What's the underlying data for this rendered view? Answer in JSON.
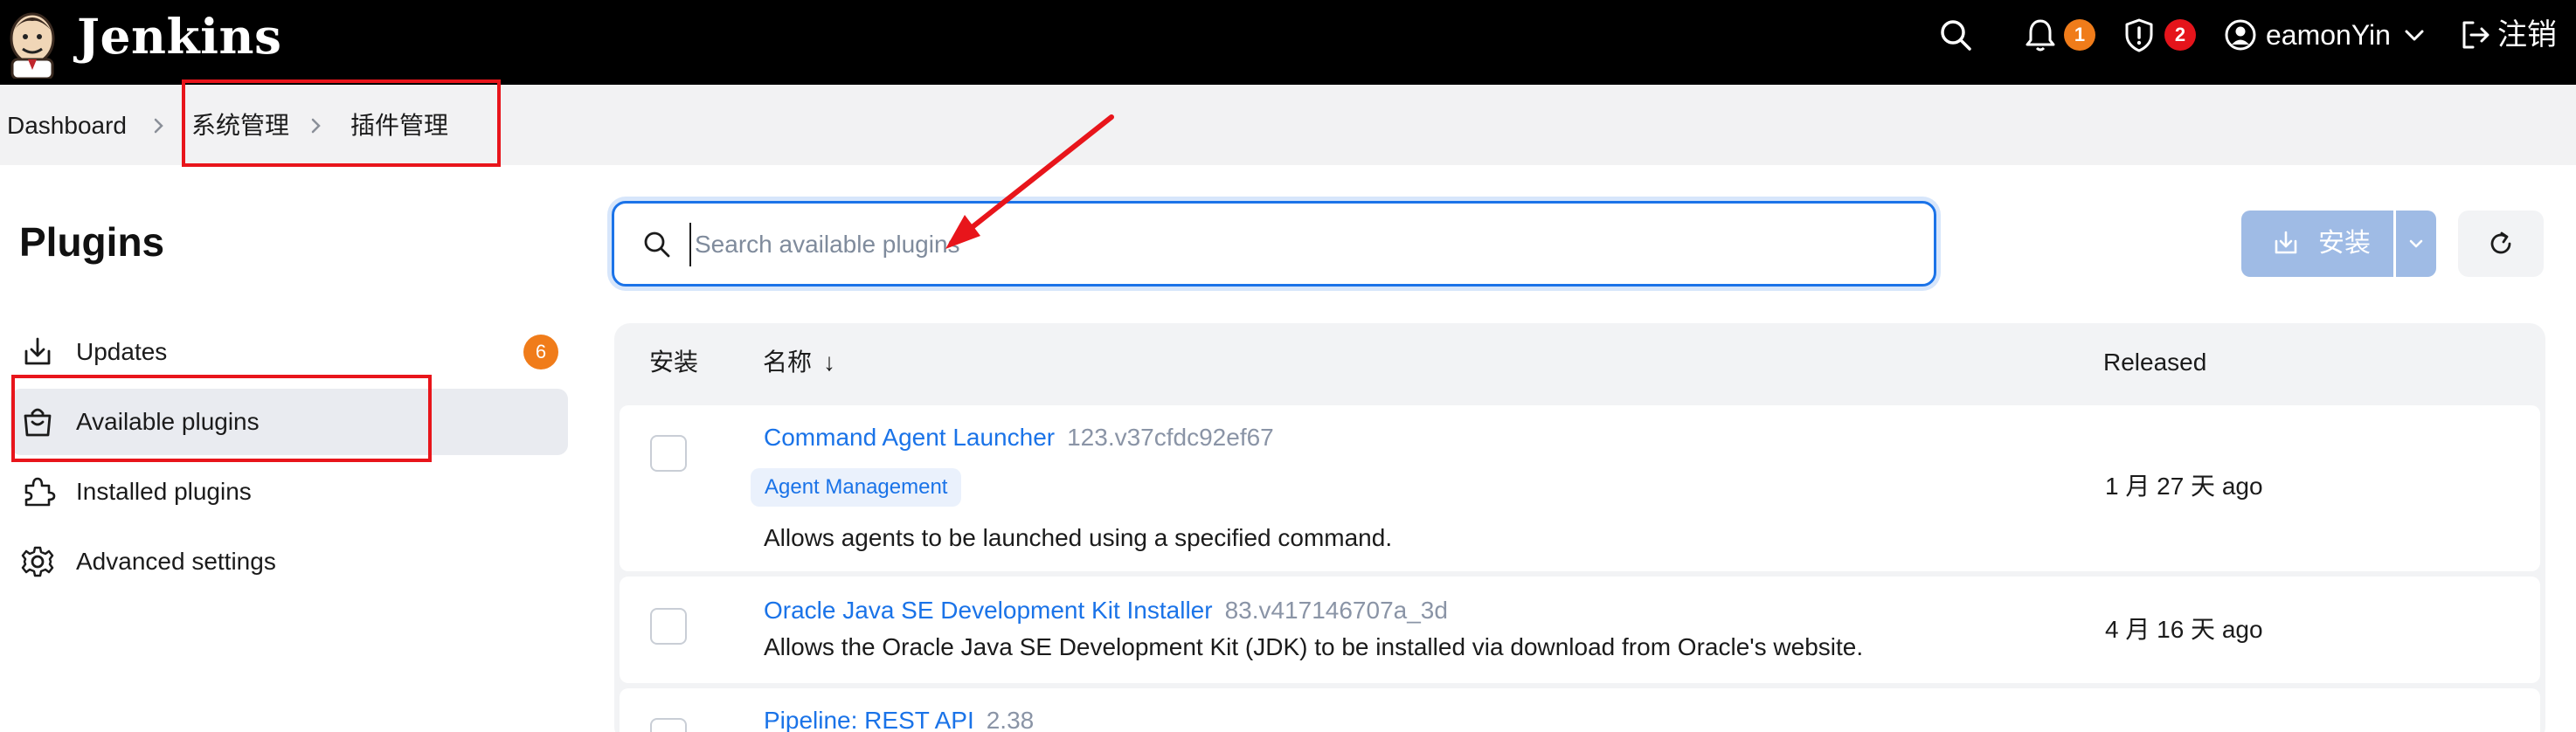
{
  "header": {
    "brand": "Jenkins",
    "notifications_count": "1",
    "security_count": "2",
    "user_name": "eamonYin",
    "logout_label": "注销",
    "colors": {
      "notification_badge": "#f07c1a",
      "security_badge": "#e5141b",
      "background": "#000000"
    }
  },
  "breadcrumb": {
    "items": [
      "Dashboard",
      "系统管理",
      "插件管理"
    ]
  },
  "sidebar": {
    "title": "Plugins",
    "items": [
      {
        "label": "Updates",
        "icon": "download-icon",
        "badge": "6"
      },
      {
        "label": "Available plugins",
        "icon": "shopping-bag-icon",
        "active": true
      },
      {
        "label": "Installed plugins",
        "icon": "puzzle-icon"
      },
      {
        "label": "Advanced settings",
        "icon": "gear-icon"
      }
    ]
  },
  "search": {
    "placeholder": "Search available plugins",
    "value": ""
  },
  "toolbar": {
    "install_label": "安装"
  },
  "table": {
    "columns": {
      "install": "安装",
      "name": "名称",
      "sort_indicator": "↓",
      "released": "Released"
    },
    "rows": [
      {
        "name": "Command Agent Launcher",
        "version": "123.v37cfdc92ef67",
        "tag": "Agent Management",
        "description": "Allows agents to be launched using a specified command.",
        "released": "1 月 27 天 ago"
      },
      {
        "name": "Oracle Java SE Development Kit Installer",
        "version": "83.v417146707a_3d",
        "description": "Allows the Oracle Java SE Development Kit (JDK) to be installed via download from Oracle's website.",
        "released": "4 月 16 天 ago"
      },
      {
        "name": "Pipeline: REST API",
        "version": "2.38"
      }
    ]
  },
  "annotations": {
    "color": "#e8151b"
  }
}
